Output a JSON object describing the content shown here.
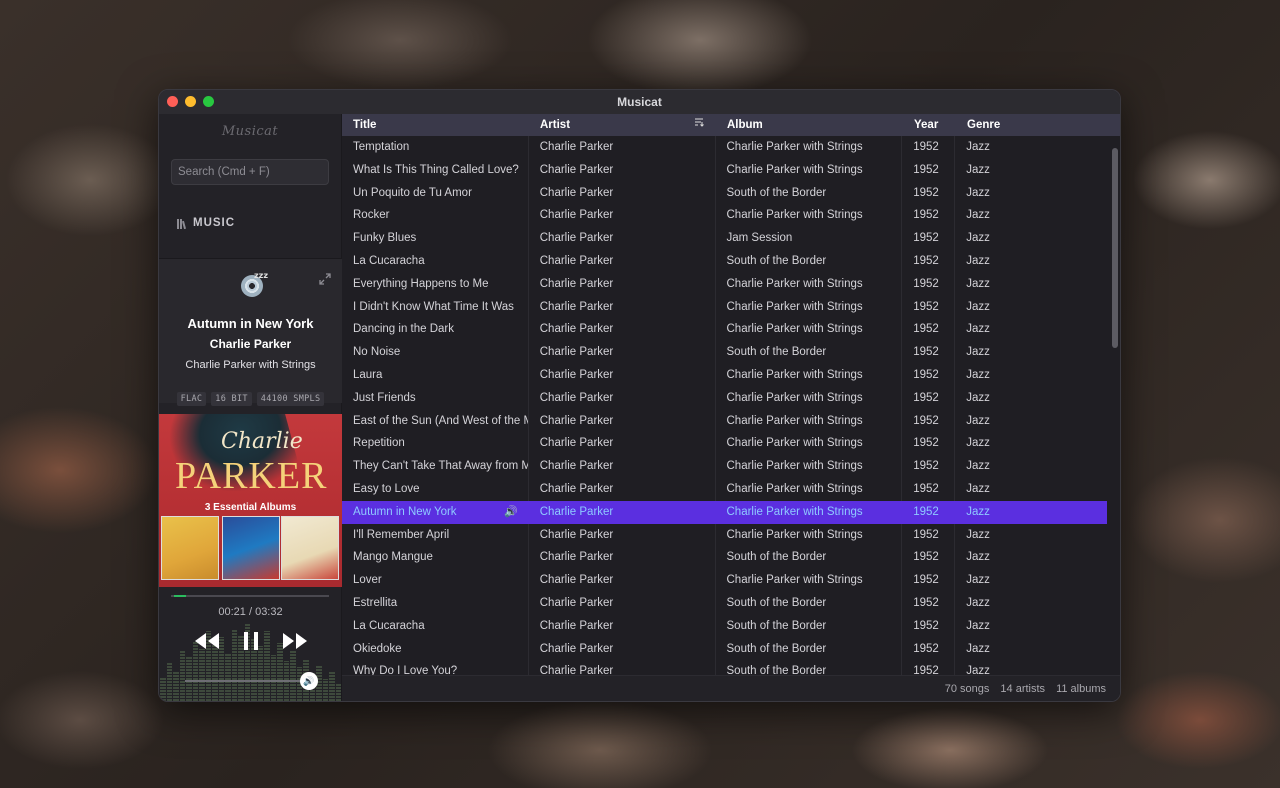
{
  "window": {
    "title": "Musicat"
  },
  "sidebar": {
    "logo": "Musicat",
    "search_placeholder": "Search (Cmd + F)",
    "music_label": "MUSIC"
  },
  "now_playing": {
    "title": "Autumn in New York",
    "artist": "Charlie Parker",
    "album": "Charlie Parker with Strings",
    "badges": [
      "FLAC",
      "16 BIT",
      "44100 SMPLS"
    ],
    "time": "00:21 / 03:32",
    "progress_fraction": 0.1,
    "volume_fraction": 1.0,
    "cover": {
      "script": "Charlie",
      "big": "PARKER",
      "sub": "3 Essential Albums"
    }
  },
  "table": {
    "headers": {
      "title": "Title",
      "artist": "Artist",
      "album": "Album",
      "year": "Year",
      "genre": "Genre"
    },
    "rows": [
      {
        "title": "Temptation",
        "artist": "Charlie Parker",
        "album": "Charlie Parker with Strings",
        "year": "1952",
        "genre": "Jazz"
      },
      {
        "title": "What Is This Thing Called Love?",
        "artist": "Charlie Parker",
        "album": "Charlie Parker with Strings",
        "year": "1952",
        "genre": "Jazz"
      },
      {
        "title": "Un Poquito de Tu Amor",
        "artist": "Charlie Parker",
        "album": "South of the Border",
        "year": "1952",
        "genre": "Jazz"
      },
      {
        "title": "Rocker",
        "artist": "Charlie Parker",
        "album": "Charlie Parker with Strings",
        "year": "1952",
        "genre": "Jazz"
      },
      {
        "title": "Funky Blues",
        "artist": "Charlie Parker",
        "album": "Jam Session",
        "year": "1952",
        "genre": "Jazz"
      },
      {
        "title": "La Cucaracha",
        "artist": "Charlie Parker",
        "album": "South of the Border",
        "year": "1952",
        "genre": "Jazz"
      },
      {
        "title": "Everything Happens to Me",
        "artist": "Charlie Parker",
        "album": "Charlie Parker with Strings",
        "year": "1952",
        "genre": "Jazz"
      },
      {
        "title": "I Didn't Know What Time It Was",
        "artist": "Charlie Parker",
        "album": "Charlie Parker with Strings",
        "year": "1952",
        "genre": "Jazz"
      },
      {
        "title": "Dancing in the Dark",
        "artist": "Charlie Parker",
        "album": "Charlie Parker with Strings",
        "year": "1952",
        "genre": "Jazz"
      },
      {
        "title": "No Noise",
        "artist": "Charlie Parker",
        "album": "South of the Border",
        "year": "1952",
        "genre": "Jazz"
      },
      {
        "title": "Laura",
        "artist": "Charlie Parker",
        "album": "Charlie Parker with Strings",
        "year": "1952",
        "genre": "Jazz"
      },
      {
        "title": "Just Friends",
        "artist": "Charlie Parker",
        "album": "Charlie Parker with Strings",
        "year": "1952",
        "genre": "Jazz"
      },
      {
        "title": "East of the Sun (And West of the M",
        "artist": "Charlie Parker",
        "album": "Charlie Parker with Strings",
        "year": "1952",
        "genre": "Jazz"
      },
      {
        "title": "Repetition",
        "artist": "Charlie Parker",
        "album": "Charlie Parker with Strings",
        "year": "1952",
        "genre": "Jazz"
      },
      {
        "title": "They Can't Take That Away from M",
        "artist": "Charlie Parker",
        "album": "Charlie Parker with Strings",
        "year": "1952",
        "genre": "Jazz"
      },
      {
        "title": "Easy to Love",
        "artist": "Charlie Parker",
        "album": "Charlie Parker with Strings",
        "year": "1952",
        "genre": "Jazz"
      },
      {
        "title": "Autumn in New York",
        "artist": "Charlie Parker",
        "album": "Charlie Parker with Strings",
        "year": "1952",
        "genre": "Jazz",
        "playing": true
      },
      {
        "title": "I'll Remember April",
        "artist": "Charlie Parker",
        "album": "Charlie Parker with Strings",
        "year": "1952",
        "genre": "Jazz"
      },
      {
        "title": "Mango Mangue",
        "artist": "Charlie Parker",
        "album": "South of the Border",
        "year": "1952",
        "genre": "Jazz"
      },
      {
        "title": "Lover",
        "artist": "Charlie Parker",
        "album": "Charlie Parker with Strings",
        "year": "1952",
        "genre": "Jazz"
      },
      {
        "title": "Estrellita",
        "artist": "Charlie Parker",
        "album": "South of the Border",
        "year": "1952",
        "genre": "Jazz"
      },
      {
        "title": "La Cucaracha",
        "artist": "Charlie Parker",
        "album": "South of the Border",
        "year": "1952",
        "genre": "Jazz"
      },
      {
        "title": "Okiedoke",
        "artist": "Charlie Parker",
        "album": "South of the Border",
        "year": "1952",
        "genre": "Jazz"
      },
      {
        "title": "Why Do I Love You?",
        "artist": "Charlie Parker",
        "album": "South of the Border",
        "year": "1952",
        "genre": "Jazz"
      }
    ]
  },
  "footer": {
    "songs": "70 songs",
    "artists": "14 artists",
    "albums": "11 albums"
  }
}
